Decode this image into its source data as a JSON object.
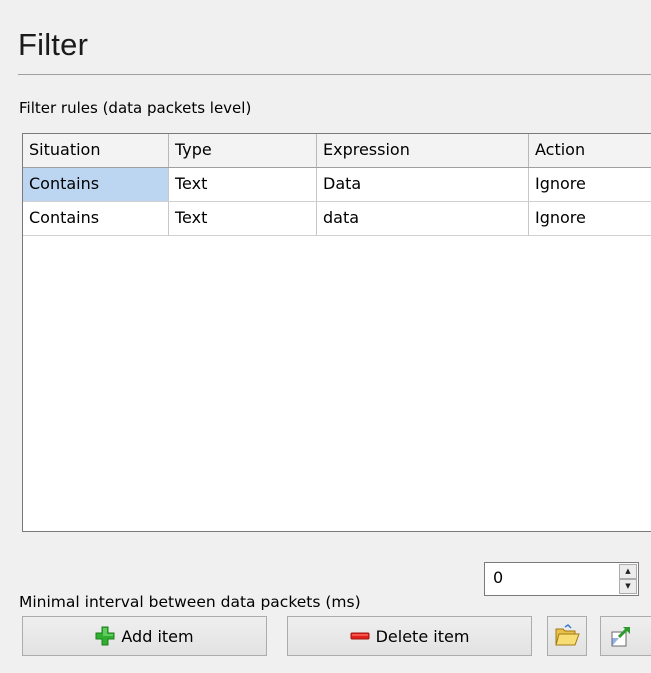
{
  "header": {
    "title": "Filter"
  },
  "rules": {
    "label": "Filter rules (data packets level)",
    "columns": [
      "Situation",
      "Type",
      "Expression",
      "Action"
    ],
    "rows": [
      [
        "Contains",
        "Text",
        "Data",
        "Ignore"
      ],
      [
        "Contains",
        "Text",
        "data",
        "Ignore"
      ]
    ]
  },
  "interval": {
    "label": "Minimal interval between data packets (ms)",
    "value": "0"
  },
  "buttons": {
    "add_label": "Add item",
    "delete_label": "Delete item",
    "open_icon": "folder-open-icon",
    "export_icon": "export-icon"
  },
  "colors": {
    "selection": "#bcd6f2",
    "add_icon": "#2fae2f",
    "delete_icon": "#e0201c"
  }
}
